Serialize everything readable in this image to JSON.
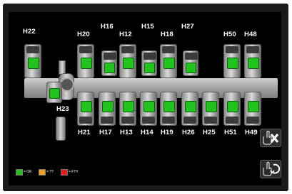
{
  "valves_top": [
    {
      "label": "H22",
      "status": "ok"
    },
    {
      "label": "H20",
      "status": "ok"
    },
    {
      "label": "H16",
      "status": "ok"
    },
    {
      "label": "H12",
      "status": "ok"
    },
    {
      "label": "H15",
      "status": "ok"
    },
    {
      "label": "H18",
      "status": "ok"
    },
    {
      "label": "H27",
      "status": "ok"
    },
    {
      "label": "H50",
      "status": "ok"
    },
    {
      "label": "H48",
      "status": "ok"
    }
  ],
  "valves_bottom": [
    {
      "label": "H23",
      "status": "ok"
    },
    {
      "label": "H21",
      "status": "ok"
    },
    {
      "label": "H17",
      "status": "ok"
    },
    {
      "label": "H13",
      "status": "ok"
    },
    {
      "label": "H14",
      "status": "ok"
    },
    {
      "label": "H19",
      "status": "ok"
    },
    {
      "label": "H26",
      "status": "ok"
    },
    {
      "label": "H25",
      "status": "ok"
    },
    {
      "label": "H51",
      "status": "ok"
    },
    {
      "label": "H49",
      "status": "ok"
    }
  ],
  "legend": [
    {
      "text": "= OK",
      "color": "#22c21f"
    },
    {
      "text": "= ??",
      "color": "#f0a020"
    },
    {
      "text": "= FTY",
      "color": "#e02020"
    }
  ],
  "colors": {
    "ok": "#22c21f",
    "background": "#000000"
  },
  "buttons": {
    "close_icon": "hand-x-icon",
    "reset_icon": "hand-cycle-icon"
  }
}
